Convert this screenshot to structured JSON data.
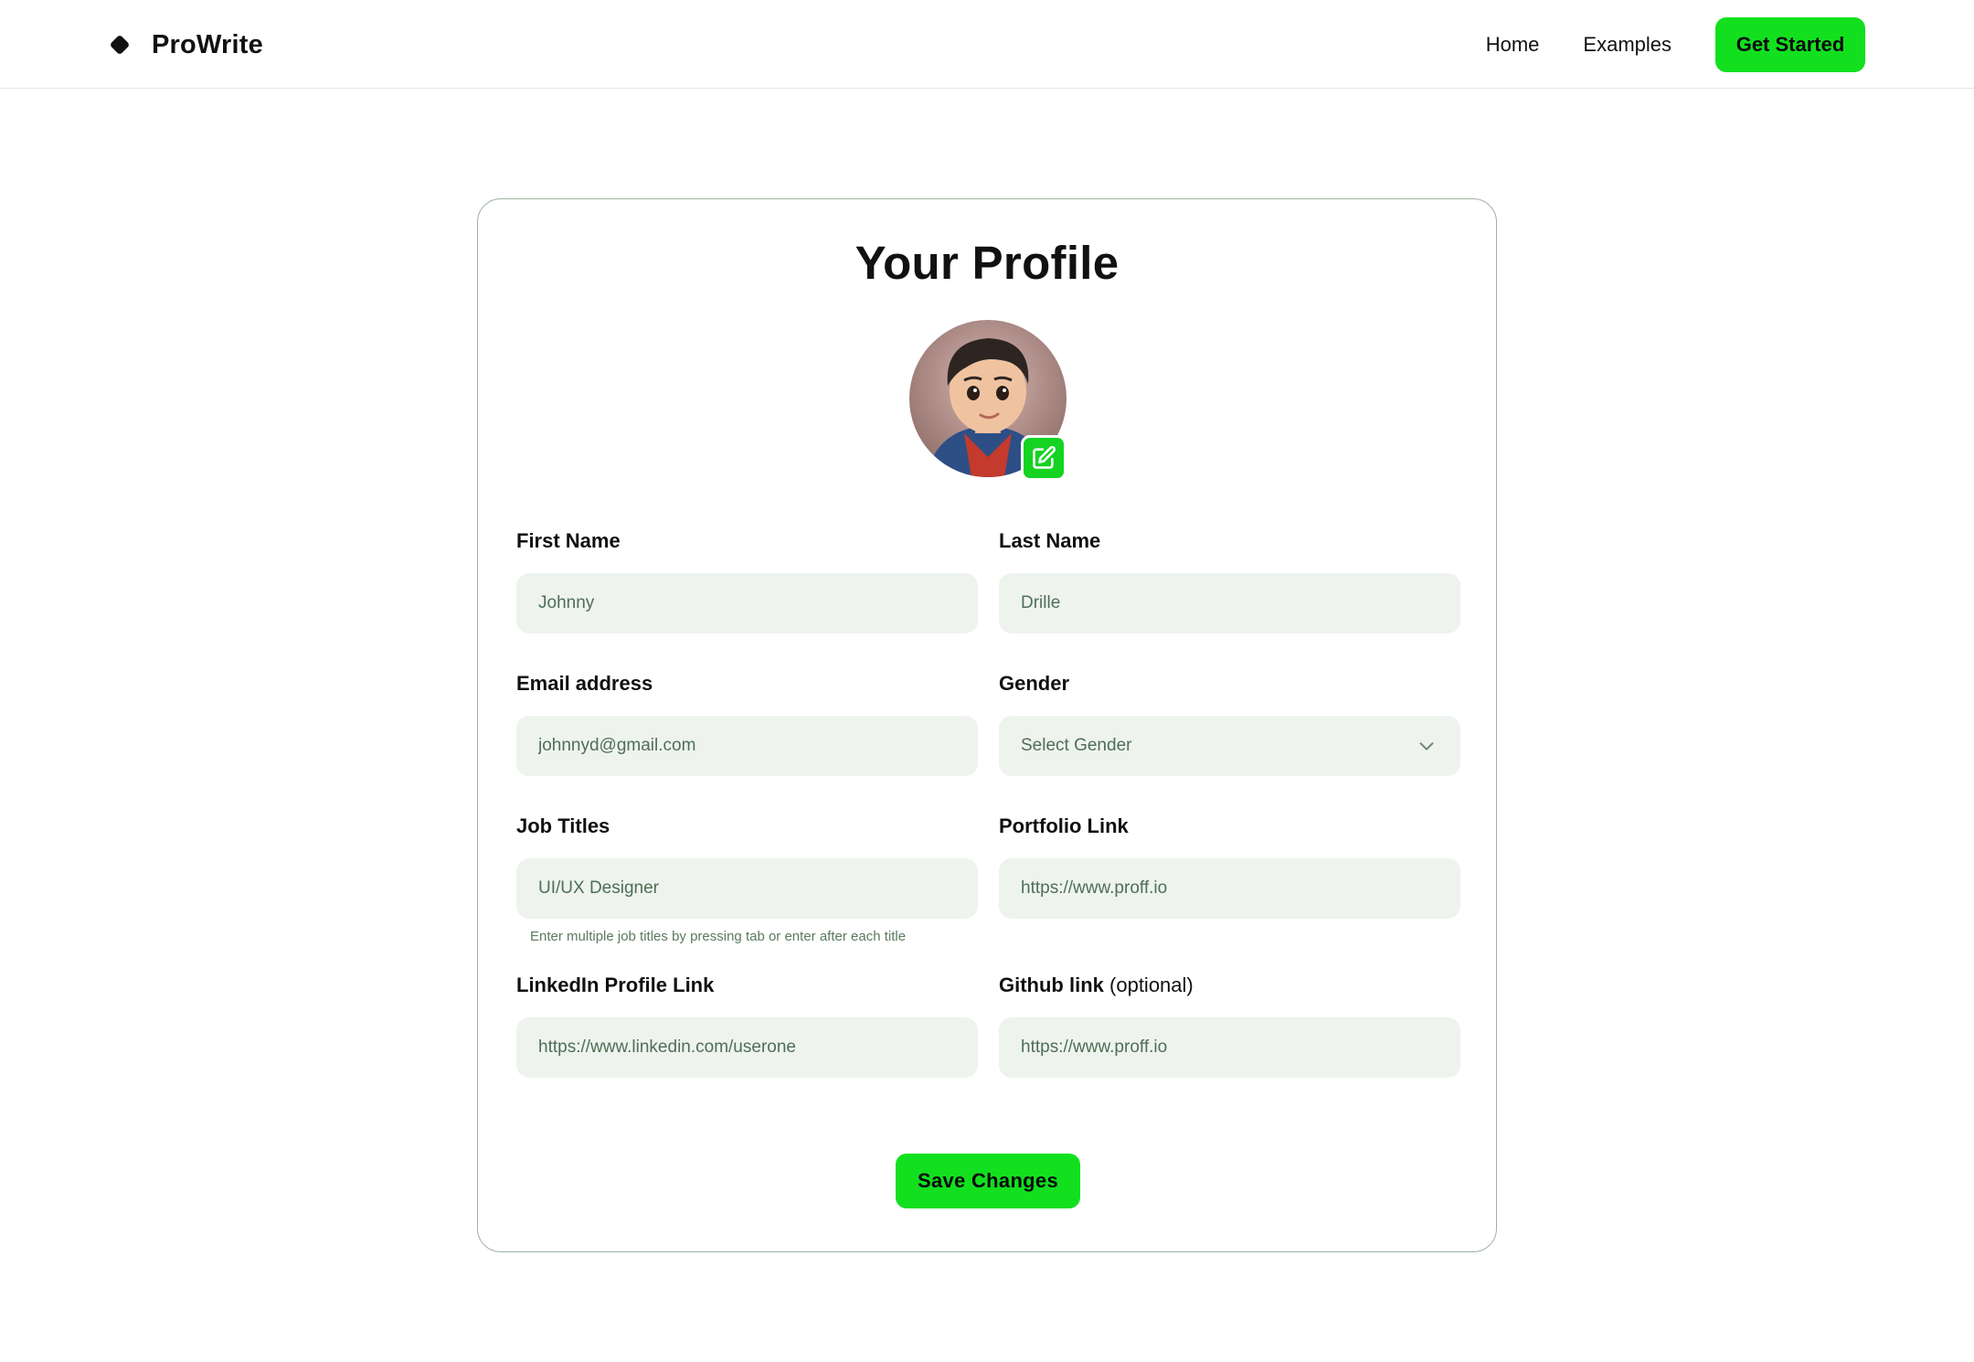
{
  "header": {
    "brand_name": "ProWrite",
    "nav": [
      "Home",
      "Examples"
    ],
    "cta_label": "Get Started"
  },
  "profile": {
    "title": "Your Profile",
    "avatar_icon": "avatar-illustration",
    "edit_icon": "edit-icon"
  },
  "form": {
    "first_name": {
      "label": "First Name",
      "value": "Johnny"
    },
    "last_name": {
      "label": "Last Name",
      "value": "Drille"
    },
    "email": {
      "label": "Email address",
      "value": "johnnyd@gmail.com"
    },
    "gender": {
      "label": "Gender",
      "value": "Select Gender"
    },
    "job_titles": {
      "label": "Job Titles",
      "value": "UI/UX Designer",
      "hint": "Enter multiple job titles by pressing tab or enter after each title"
    },
    "portfolio": {
      "label": "Portfolio Link",
      "value": "https://www.proff.io"
    },
    "linkedin": {
      "label": "LinkedIn Profile Link",
      "value": "https://www.linkedin.com/userone"
    },
    "github": {
      "label": "Github link",
      "optional": "(optional)",
      "value": "https://www.proff.io"
    },
    "save_label": "Save Changes"
  },
  "colors": {
    "accent": "#12e01f",
    "field_bg": "#eef3ee",
    "card_border": "#9db29f"
  }
}
